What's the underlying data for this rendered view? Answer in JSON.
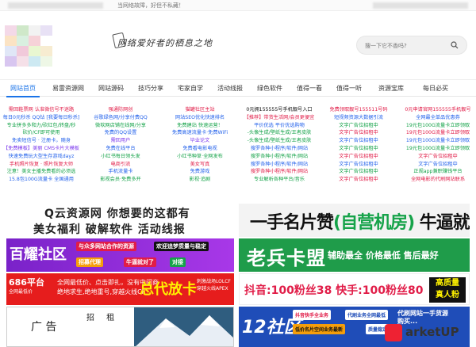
{
  "topbar": {
    "note": "当网络故障，好但不私藏！"
  },
  "header": {
    "slogan": "网络爱好者的栖息之地",
    "search_placeholder": "搜一下它不香吗?",
    "logo_colors": [
      "#f4d9e8",
      "#cfe8c9",
      "#f2f2f2",
      "#e8e1f5",
      "#fbe3c4",
      "#d9f0e0",
      "#f6d2d8",
      "#fff",
      "#e0e7f7",
      "#f1c9da",
      "#e9f7d1",
      "#f7ecd1",
      "#d8c6f0",
      "#f5e0e8",
      "#cde9f2",
      "#eef7e6"
    ]
  },
  "nav": {
    "items": [
      "网站首页",
      "易雷资源网",
      "网站源码",
      "技巧分享",
      "宅家自学",
      "活动线报",
      "绿色软件",
      "值得一看",
      "值得一听",
      "资源宝库",
      "每日必买"
    ]
  },
  "links": {
    "columns": [
      {
        "items": [
          {
            "t": "需回鞋票网 认准微信号不迷路",
            "c": "#e11d48"
          },
          {
            "t": "每日0元秒杀 QQ钻 [我要每日秒杀]",
            "c": "#2563eb"
          },
          {
            "t": "专业拼多多和力/砍红包/转盘/秒",
            "c": "#16a34a"
          },
          {
            "t": "砍价/CF即可使用",
            "c": "#16a34a"
          },
          {
            "t": "免卖短信号 · 注册卡，随身",
            "c": "#2563eb"
          },
          {
            "t": "【免费模板】美丽 CMS卡片大模板",
            "c": "#7c3aed"
          },
          {
            "t": "快速免费玩大型生存游戏dayz",
            "c": "#2563eb"
          },
          {
            "t": "手机照片恢复 · 照片恢复大师",
            "c": "#e11d48"
          },
          {
            "t": "注意！美女主播免费看的必须选",
            "c": "#16a34a"
          },
          {
            "t": "15.8包100G流量卡 全国通用",
            "c": "#2563eb"
          }
        ]
      },
      {
        "items": [
          {
            "t": "强通防网创",
            "c": "#e11d48"
          },
          {
            "t": "谷歌绿色网/分享付费QQ",
            "c": "#2563eb"
          },
          {
            "t": "微软网店铺在线网/分享",
            "c": "#16a34a"
          },
          {
            "t": "免费的QQ设置",
            "c": "#2563eb"
          },
          {
            "t": "需回用户",
            "c": "#7c3aed"
          },
          {
            "t": "免费在线平台",
            "c": "#2563eb"
          },
          {
            "t": "小红书每日领头发",
            "c": "#16a34a"
          },
          {
            "t": "电商引流",
            "c": "#e11d48"
          },
          {
            "t": "手机流量卡",
            "c": "#2563eb"
          },
          {
            "t": "影视会员·免费多开",
            "c": "#16a34a"
          }
        ]
      },
      {
        "items": [
          {
            "t": "猫罐社区主站",
            "c": "#e11d48"
          },
          {
            "t": "网站SEO优化快速排名",
            "c": "#2563eb"
          },
          {
            "t": "免费建站 快速运营！",
            "c": "#16a34a"
          },
          {
            "t": "免费高速流量卡·免费WiFi",
            "c": "#2563eb"
          },
          {
            "t": "毕业论文",
            "c": "#7c3aed"
          },
          {
            "t": "免费看电影电视",
            "c": "#2563eb"
          },
          {
            "t": "小红书种草·全网发布",
            "c": "#16a34a"
          },
          {
            "t": "美女写真",
            "c": "#e11d48"
          },
          {
            "t": "免费游戏",
            "c": "#2563eb"
          },
          {
            "t": "影视·追剧",
            "c": "#16a34a"
          }
        ]
      },
      {
        "items": [
          {
            "t": "0元拥155555号手机靓号入口",
            "c": "#111"
          },
          {
            "t": "【推荐】带货生活网/会员更便宜",
            "c": "#e11d48"
          },
          {
            "t": "平价优选 平价优选购物",
            "c": "#2563eb"
          },
          {
            "t": "-头像生成/壁纸生成/王者皮肤",
            "c": "#16a34a"
          },
          {
            "t": "-头像生成/壁纸生成/王者皮肤",
            "c": "#16a34a"
          },
          {
            "t": "搜罗各种小程序/软件/网站",
            "c": "#2563eb"
          },
          {
            "t": "搜罗各种小程序/软件/网站",
            "c": "#16a34a"
          },
          {
            "t": "搜罗各种小程序/软件/网站",
            "c": "#2563eb"
          },
          {
            "t": "搜罗各种小程序/软件/网站",
            "c": "#e11d48"
          },
          {
            "t": "专业解析各种平台/音乐",
            "c": "#16a34a"
          }
        ]
      },
      {
        "items": [
          {
            "t": "免费领取靓号155511号码",
            "c": "#e11d48"
          },
          {
            "t": "短视频资源大数据引流",
            "c": "#2563eb"
          },
          {
            "t": "文字广告位招租中",
            "c": "#16a34a"
          },
          {
            "t": "文字广告位招租中",
            "c": "#e11d48"
          },
          {
            "t": "文字广告位招租中",
            "c": "#2563eb"
          },
          {
            "t": "文字广告位招租中",
            "c": "#16a34a"
          },
          {
            "t": "文字广告位招租中",
            "c": "#e11d48"
          },
          {
            "t": "文字广告位招租中",
            "c": "#2563eb"
          },
          {
            "t": "文字广告位招租中",
            "c": "#16a34a"
          },
          {
            "t": "文字广告位招租中",
            "c": "#e11d48"
          }
        ]
      },
      {
        "items": [
          {
            "t": "0元申请官网155555手机靓号",
            "c": "#e11d48"
          },
          {
            "t": "全网最全单品优惠券",
            "c": "#2563eb"
          },
          {
            "t": "19元包100G流量卡立即领取",
            "c": "#16a34a"
          },
          {
            "t": "19元包100G流量卡立即领取",
            "c": "#e11d48"
          },
          {
            "t": "19元包100G流量卡立即领取",
            "c": "#2563eb"
          },
          {
            "t": "19元包100G流量卡立即领取",
            "c": "#16a34a"
          },
          {
            "t": "文字广告位招租中",
            "c": "#e11d48"
          },
          {
            "t": "文字广告位招租中",
            "c": "#2563eb"
          },
          {
            "t": "正规app兼职赚钱平台",
            "c": "#16a34a"
          },
          {
            "t": "全网电影的代刷网站联系",
            "c": "#e11d48"
          }
        ]
      }
    ]
  },
  "banners": {
    "q": {
      "line1": "Q云资源网 你想要的这都有",
      "line2": "美女福利 破解软件 活动线报"
    },
    "sz": {
      "text_a": "一手名片赞",
      "text_b": "(自营机房)",
      "text_c": " 牛逼就完了"
    },
    "by": {
      "name": "百耀社区",
      "chip1": "欢迎追梦质量与稳定",
      "chip2": "对接",
      "chip3": "招募代理",
      "chip4": "牛逼就对了",
      "chip5": "欢迎追梦质量与稳定",
      "chip6": "与众多网站合作的资源"
    },
    "lb": {
      "name": "老兵卡盟",
      "desc": "辅助最全 价格最低 售后最好"
    },
    "ck": {
      "b1": "686平台",
      "b2": "全网最低价",
      "mid1": "全网最低价、点击即扎，没有中间商",
      "mid2": "绝地求生,绝地重号,穿越火线CF",
      "big": "总代放卡",
      "side1": "刺激战场LOLCF",
      "side2": "穿越火线APEX"
    },
    "dy": {
      "text": "抖音:100粉丝38  快手:100粉丝80",
      "box1": "高质量",
      "box2": "真人粉"
    },
    "ad": {
      "a1": "广 告",
      "a2": "招 租"
    },
    "twelve": {
      "n": "12社区",
      "c1": "抖音快手全业务",
      "c2": "代刷业务全网最低",
      "c3": "低价名片空间业务最新",
      "c4": "质量稳定",
      "r1": "代刷网站一手货源",
      "r2": "购买..."
    }
  },
  "watermark": {
    "text": "arketUP"
  }
}
